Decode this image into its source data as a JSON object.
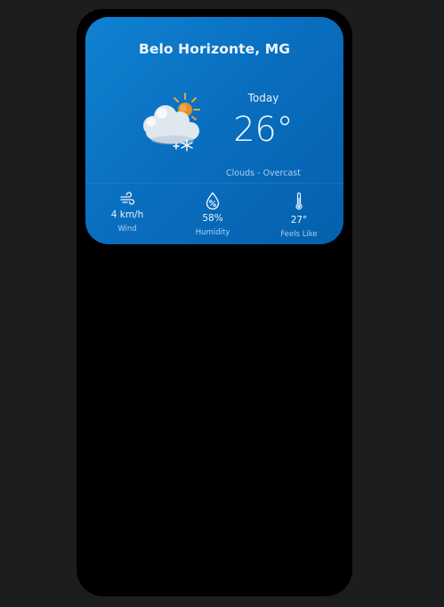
{
  "weather": {
    "city": "Belo Horizonte, MG",
    "day_label": "Today",
    "temperature": "26°",
    "condition": "Clouds - Overcast",
    "icon": "partly-cloudy-snow-icon"
  },
  "stats": {
    "wind": {
      "icon": "wind-icon",
      "value": "4 km/h",
      "label": "Wind"
    },
    "humidity": {
      "icon": "humidity-icon",
      "value": "58%",
      "label": "Humidity"
    },
    "feels_like": {
      "icon": "thermometer-icon",
      "value": "27°",
      "label": "Feels Like"
    }
  },
  "colors": {
    "page_background": "#1b1d1f",
    "phone_background": "#000000",
    "card_gradient_start": "#1082d2",
    "card_gradient_end": "#0460ad"
  }
}
